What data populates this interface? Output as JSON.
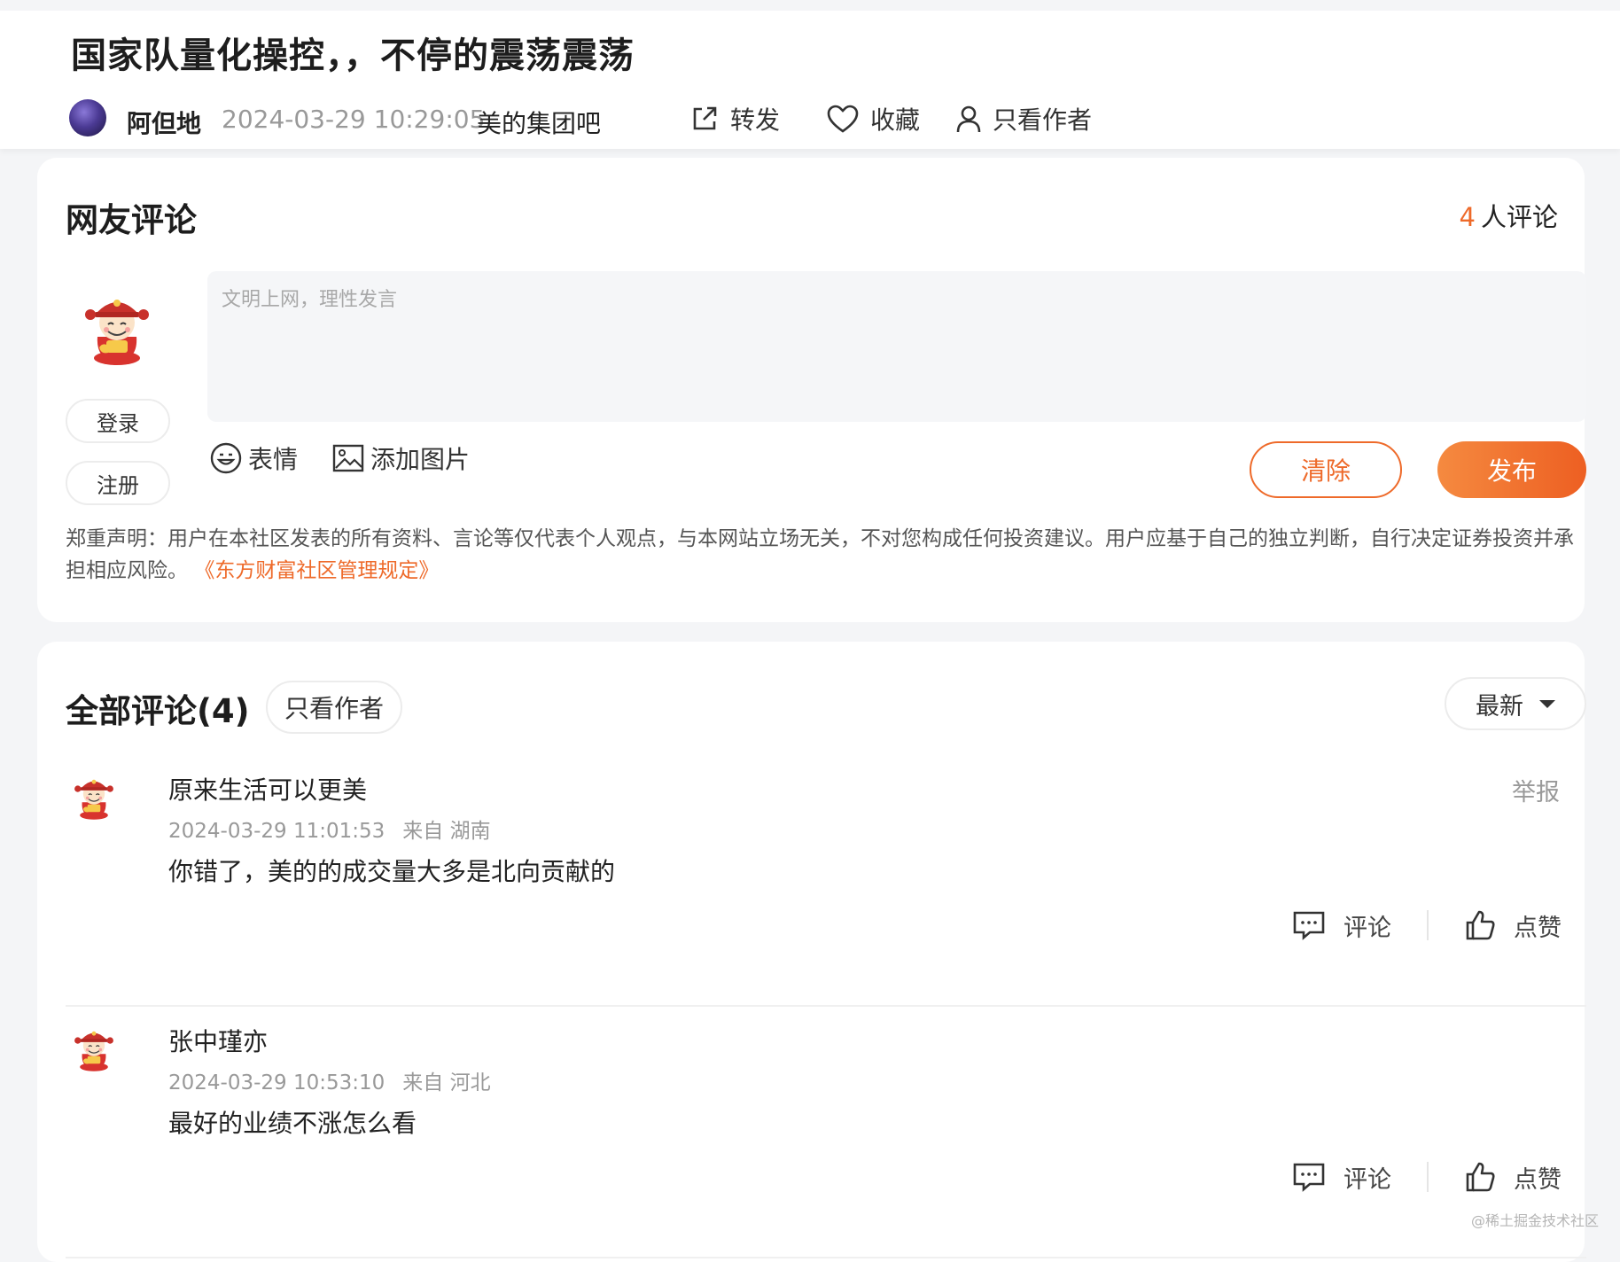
{
  "post": {
    "title": "国家队量化操控，，不停的震荡震荡",
    "author": "阿但地",
    "time": "2024-03-29 10:29:05",
    "bar": "美的集团吧",
    "actions": {
      "forward": "转发",
      "favorite": "收藏",
      "author_only": "只看作者"
    }
  },
  "comment_box": {
    "title": "网友评论",
    "count_num": "4",
    "count_suffix": "人评论",
    "login": "登录",
    "register": "注册",
    "placeholder": "文明上网，理性发言",
    "emoji": "表情",
    "add_image": "添加图片",
    "clear": "清除",
    "publish": "发布",
    "disclaimer": "郑重声明：用户在本社区发表的所有资料、言论等仅代表个人观点，与本网站立场无关，不对您构成任何投资建议。用户应基于自己的独立判断，自行决定证券投资并承担相应风险。",
    "disclaimer_link": "《东方财富社区管理规定》"
  },
  "comments_section": {
    "title": "全部评论(4)",
    "author_only": "只看作者",
    "sort": "最新",
    "items": [
      {
        "user": "原来生活可以更美",
        "time": "2024-03-29 11:01:53",
        "location": "来自 湖南",
        "text": "你错了，美的的成交量大多是北向贡献的",
        "report": "举报",
        "reply": "评论",
        "like": "点赞"
      },
      {
        "user": "张中瑾亦",
        "time": "2024-03-29 10:53:10",
        "location": "来自 河北",
        "text": "最好的业绩不涨怎么看",
        "reply": "评论",
        "like": "点赞"
      }
    ]
  },
  "watermark": "@稀土掘金技术社区",
  "colors": {
    "accent": "#ee6a2a",
    "muted": "#999999"
  }
}
